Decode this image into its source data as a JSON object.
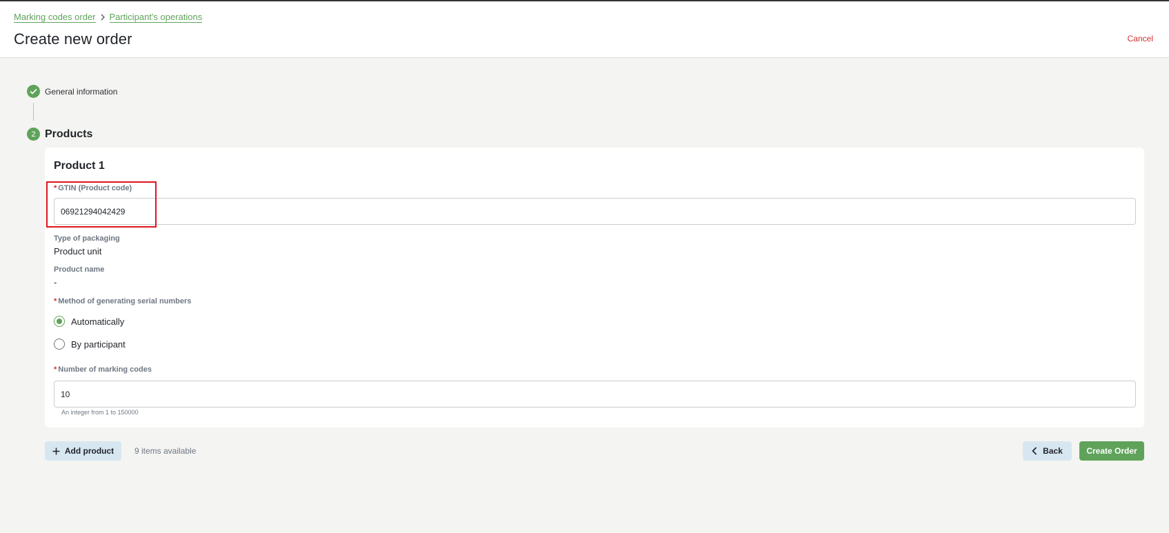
{
  "breadcrumb": {
    "items": [
      "Marking codes order",
      "Participant's operations"
    ]
  },
  "header": {
    "title": "Create new order",
    "cancel_label": "Cancel"
  },
  "steps": [
    {
      "label": "General information",
      "state": "completed"
    },
    {
      "number": "2",
      "label": "Products",
      "state": "active"
    }
  ],
  "product": {
    "title": "Product 1",
    "gtin": {
      "label": "GTIN (Product code)",
      "value": "06921294042429",
      "required": true
    },
    "packaging": {
      "label": "Type of packaging",
      "value": "Product unit"
    },
    "product_name": {
      "label": "Product name",
      "value": "-"
    },
    "serial_method": {
      "label": "Method of generating serial numbers",
      "required": true,
      "options": [
        {
          "label": "Automatically",
          "checked": true
        },
        {
          "label": "By participant",
          "checked": false
        }
      ]
    },
    "marking_codes": {
      "label": "Number of marking codes",
      "value": "10",
      "hint": "An integer from 1 to 150000",
      "required": true
    }
  },
  "footer": {
    "add_product_label": "Add product",
    "items_available": "9 items available",
    "back_label": "Back",
    "create_label": "Create Order"
  },
  "colors": {
    "accent": "#5fa35a",
    "danger": "#d0312d",
    "secondary_button": "#d7e7f1",
    "highlight": "#e0141e"
  },
  "icons": [
    "chevron-right-icon",
    "check-icon",
    "plus-icon",
    "chevron-left-icon"
  ]
}
